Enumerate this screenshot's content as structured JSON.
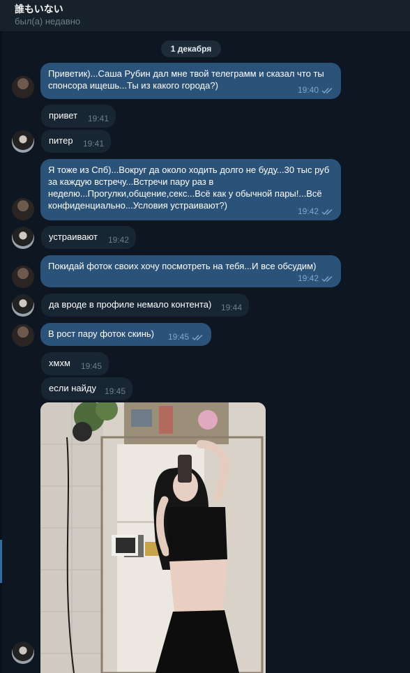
{
  "header": {
    "contact_name": "誰もいない",
    "status": "был(а) недавно"
  },
  "date_separator": "1 декабря",
  "messages": [
    {
      "side": "out",
      "text": "Приветик)...Саша Рубин дал мне твой телеграмм и сказал что ты спонсора ищешь...Ты из какого города?)",
      "time": "19:40",
      "read": true
    },
    {
      "side": "in",
      "text": "привет",
      "time": "19:41"
    },
    {
      "side": "in",
      "text": "питер",
      "time": "19:41"
    },
    {
      "side": "out",
      "text": "Я тоже из Спб)...Вокруг да около ходить долго не буду...30 тыс руб за каждую встречу...Встречи пару раз в неделю...Прогулки,общение,секс...Всё как у обычной пары!...Всё конфиденциально...Условия устраивают?)",
      "time": "19:42",
      "read": true
    },
    {
      "side": "in",
      "text": "устраивают",
      "time": "19:42"
    },
    {
      "side": "out",
      "text": "Покидай фоток своих хочу посмотреть на тебя...И все обсудим)",
      "time": "19:42",
      "read": true
    },
    {
      "side": "in",
      "text": "да вроде в профиле немало контента)",
      "time": "19:44"
    },
    {
      "side": "out",
      "text": "В рост пару фоток скинь)",
      "time": "19:45",
      "read": true
    },
    {
      "side": "in",
      "text": "хмхм",
      "time": "19:45"
    },
    {
      "side": "in",
      "text": "если найду",
      "time": "19:45"
    }
  ],
  "colors": {
    "background": "#0e1621",
    "header": "#17212b",
    "outgoing_bubble": "#2b5278",
    "incoming_bubble": "#182533",
    "read_ticks": "#7da8d3"
  }
}
